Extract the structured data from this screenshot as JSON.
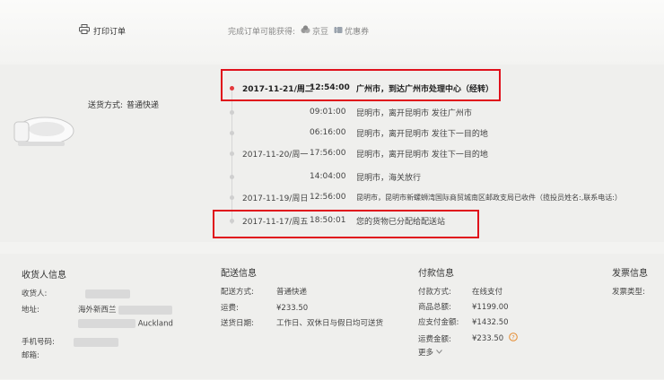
{
  "toolbar": {
    "print_label": "打印订单",
    "rewards_label": "完成订单可能获得:",
    "reward_items": [
      "京豆",
      "优惠券"
    ]
  },
  "product": {
    "shipping_method_label": "送货方式:",
    "shipping_method_value": "普通快递"
  },
  "tracking": [
    {
      "date": "2017-11-21/周二",
      "time": "12:54:00",
      "msg": "广州市，到达广州市处理中心（经转）",
      "active": true
    },
    {
      "date": "",
      "time": "09:01:00",
      "msg": "昆明市，离开昆明市 发往广州市"
    },
    {
      "date": "",
      "time": "06:16:00",
      "msg": "昆明市，离开昆明市 发往下一目的地"
    },
    {
      "date": "2017-11-20/周一",
      "time": "17:56:00",
      "msg": "昆明市，离开昆明市 发往下一目的地"
    },
    {
      "date": "",
      "time": "14:04:00",
      "msg": "昆明市，海关放行"
    },
    {
      "date": "2017-11-19/周日",
      "time": "12:56:00",
      "msg": "昆明市，昆明市新螺蛳湾国际商贸城南区邮政支局已收件（揽投员姓名:,联系电话:）"
    },
    {
      "date": "2017-11-17/周五",
      "time": "18:50:01",
      "msg": "您的货物已分配给配送站"
    }
  ],
  "receiver": {
    "title": "收货人信息",
    "name_label": "收货人:",
    "address_label": "地址:",
    "address_line1": "海外新西兰",
    "address_line2": "Auckland",
    "phone_label": "手机号码:",
    "email_label": "邮箱:"
  },
  "delivery": {
    "title": "配送信息",
    "method_label": "配送方式:",
    "method_value": "普通快递",
    "fee_label": "运费:",
    "fee_value": "¥233.50",
    "date_label": "送货日期:",
    "date_value": "工作日、双休日与假日均可送货"
  },
  "payment": {
    "title": "付款信息",
    "method_label": "付款方式:",
    "method_value": "在线支付",
    "goods_total_label": "商品总额:",
    "goods_total_value": "¥1199.00",
    "payable_label": "应支付金额:",
    "payable_value": "¥1432.50",
    "freight_label": "运费金额:",
    "freight_value": "¥233.50",
    "more_label": "更多"
  },
  "invoice": {
    "title": "发票信息",
    "type_label": "发票类型:"
  },
  "colors": {
    "highlight": "#e0101b",
    "active_dot": "#e4393c"
  }
}
